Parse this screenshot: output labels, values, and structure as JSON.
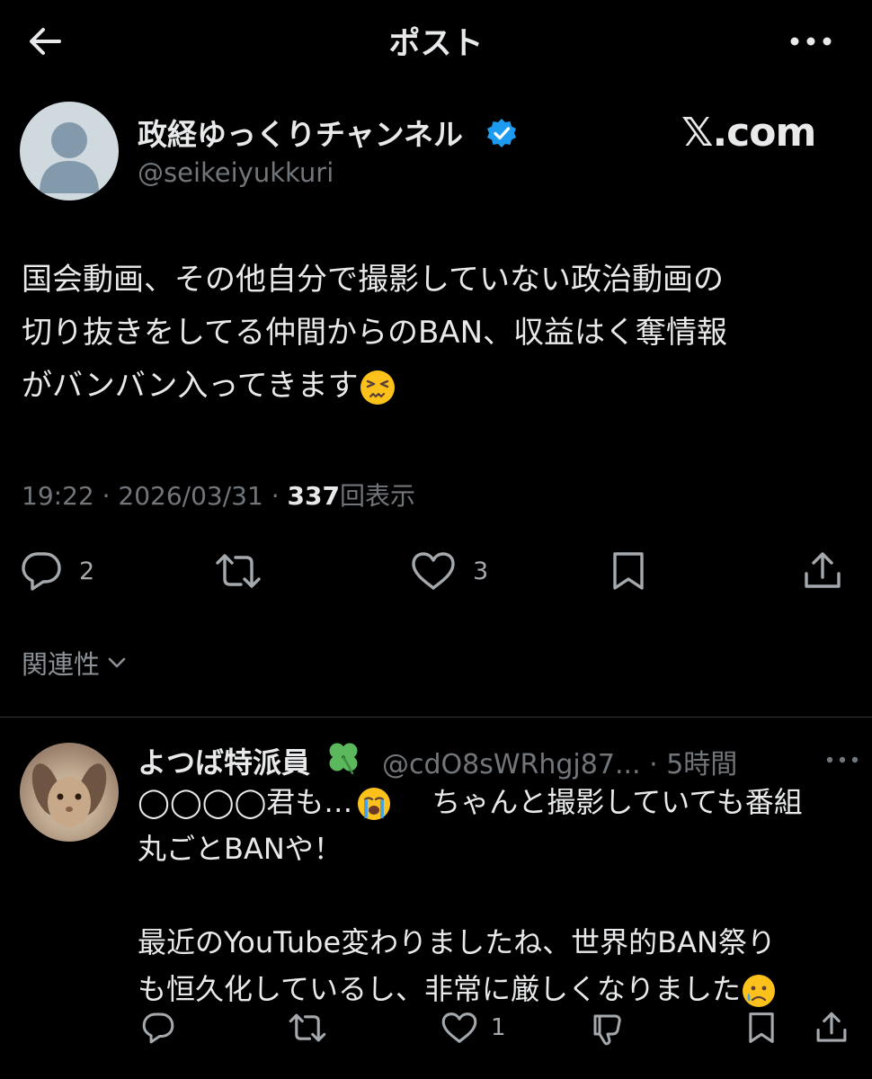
{
  "header": {
    "title": "ポスト",
    "back_icon": "back-arrow-icon",
    "more_icon": "more-horizontal-icon"
  },
  "post": {
    "author_name": "政経ゆっくりチャンネル",
    "author_handle": "@seikeiyukkuri",
    "watermark": "𝕏.com",
    "text_lines": [
      "国会動画、その他自分で撮影していない政治動画の",
      "切り抜きをしてる仲間からのBAN、収益はく奪情報",
      "がバンバン入ってきます"
    ],
    "time": "19:22",
    "date": "2026/03/31",
    "views": "337",
    "views_label": "回表示",
    "separator": "·",
    "replies": "2",
    "likes": "3"
  },
  "sort": {
    "label": "関連性"
  },
  "reply": {
    "author_name": "よつば特派員",
    "author_handle": "@cdO8sWRhgj87...",
    "separator": "·",
    "time": "5時間",
    "text_line1_a": "◯◯◯◯君も…",
    "text_line1_b": "ちゃんと撮影していても番組",
    "text_line2": "丸ごとBANや！",
    "text_line3": "最近のYouTube変わりましたね、世界的BAN祭り",
    "text_line4": "も恒久化しているし、非常に厳しくなりました",
    "likes": "1"
  },
  "colors": {
    "background": "#000000",
    "text": "#e7e9ea",
    "secondary": "#71767b",
    "verified": "#1d9bf0",
    "divider": "#2f3336"
  }
}
